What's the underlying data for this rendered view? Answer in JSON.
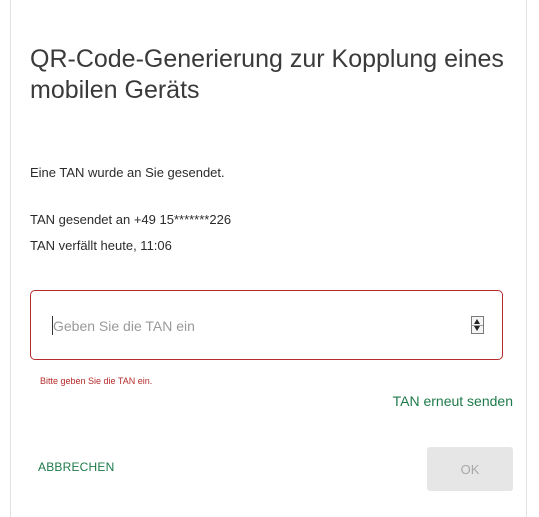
{
  "dialog": {
    "title": "QR-Code-Generierung zur Kopplung eines mobilen Geräts",
    "info": {
      "tan_sent": "Eine TAN wurde an Sie gesendet.",
      "sent_to": "TAN gesendet an +49 15*******226",
      "expires": "TAN verfällt heute, 11:06"
    },
    "tan_input": {
      "value": "",
      "placeholder": "Geben Sie die TAN ein"
    },
    "error_message": "Bitte geben Sie die TAN ein.",
    "resend_link": "TAN erneut senden",
    "buttons": {
      "cancel": "ABBRECHEN",
      "ok": "OK"
    },
    "colors": {
      "accent_green": "#1f7a4a",
      "error_red": "#b52b2b",
      "disabled_bg": "#e6e6e6"
    }
  }
}
